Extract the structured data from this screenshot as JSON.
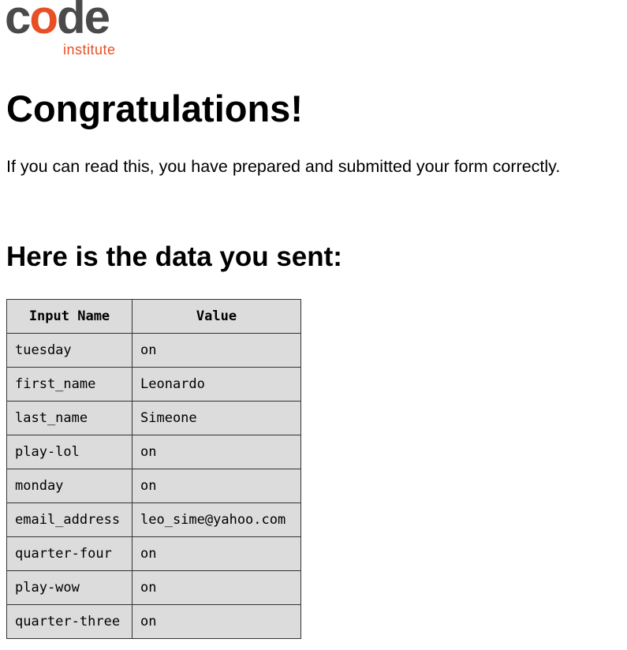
{
  "logo": {
    "word_dark_1": "c",
    "word_accent": "o",
    "word_dark_2": "de",
    "sub": "institute",
    "colors": {
      "dark": "#4a4a4a",
      "accent": "#e84f24"
    }
  },
  "heading": "Congratulations!",
  "message": "If you can read this, you have prepared and submitted your form correctly.",
  "subheading": "Here is the data you sent:",
  "table": {
    "headers": [
      "Input Name",
      "Value"
    ],
    "rows": [
      [
        "tuesday",
        "on"
      ],
      [
        "first_name",
        "Leonardo"
      ],
      [
        "last_name",
        "Simeone"
      ],
      [
        "play-lol",
        "on"
      ],
      [
        "monday",
        "on"
      ],
      [
        "email_address",
        "leo_sime@yahoo.com"
      ],
      [
        "quarter-four",
        "on"
      ],
      [
        "play-wow",
        "on"
      ],
      [
        "quarter-three",
        "on"
      ]
    ]
  }
}
